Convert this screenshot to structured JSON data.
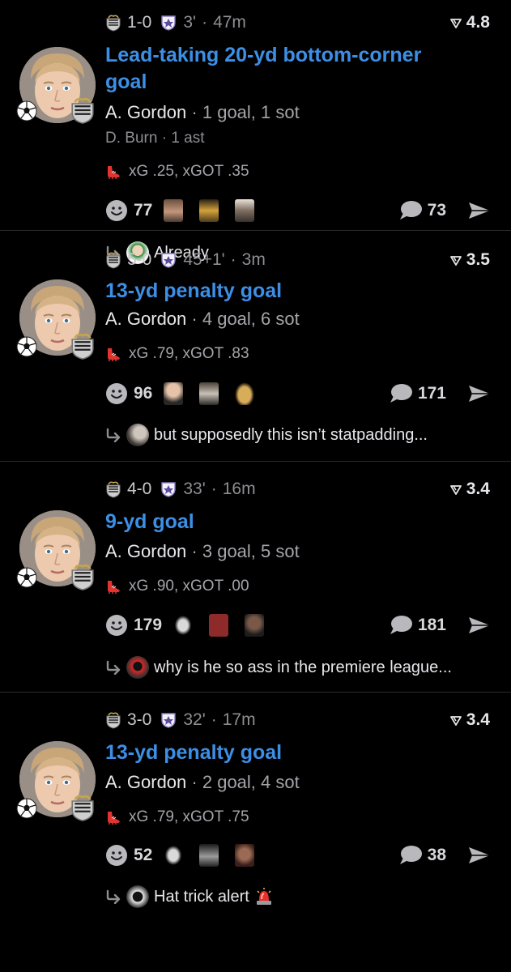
{
  "feed": {
    "cards": [
      {
        "score": "1-0",
        "minute": "3'",
        "time_ago": "47m",
        "rating": "4.8",
        "title_line1": "Lead-taking 20-yd bottom-corner",
        "title_line2": "goal",
        "player": "A. Gordon",
        "player_stat": "1 goal, 1 sot",
        "assist_player": "D. Burn",
        "assist_stat": "1 ast",
        "xg": "xG .25, xGOT .35",
        "reaction_count": "77",
        "comment_count": "73",
        "reply_text": "Already"
      },
      {
        "score": "5-0",
        "minute": "45+1'",
        "time_ago": "3m",
        "rating": "3.5",
        "title_line1": "13-yd penalty goal",
        "title_line2": "",
        "player": "A. Gordon",
        "player_stat": "4 goal, 6 sot",
        "assist_player": "",
        "assist_stat": "",
        "xg": "xG .79, xGOT .83",
        "reaction_count": "96",
        "comment_count": "171",
        "reply_text": "but supposedly this isn’t statpadding..."
      },
      {
        "score": "4-0",
        "minute": "33'",
        "time_ago": "16m",
        "rating": "3.4",
        "title_line1": "9-yd goal",
        "title_line2": "",
        "player": "A. Gordon",
        "player_stat": "3 goal, 5 sot",
        "assist_player": "",
        "assist_stat": "",
        "xg": "xG .90, xGOT .00",
        "reaction_count": "179",
        "comment_count": "181",
        "reply_text": "why is he so ass in the premiere league..."
      },
      {
        "score": "3-0",
        "minute": "32'",
        "time_ago": "17m",
        "rating": "3.4",
        "title_line1": "13-yd penalty goal",
        "title_line2": "",
        "player": "A. Gordon",
        "player_stat": "2 goal, 4 sot",
        "assist_player": "",
        "assist_stat": "",
        "xg": "xG .79, xGOT .75",
        "reaction_count": "52",
        "comment_count": "38",
        "reply_text": "Hat trick alert"
      }
    ]
  },
  "separator": "·",
  "icons": {
    "team_crest": "newcastle-crest-icon",
    "opponent_crest": "opponent-crest-icon",
    "rating": "rating-chevron-icon",
    "goal": "soccer-ball-icon",
    "shoe": "boot-icon",
    "react": "smiley-react-icon",
    "comment": "comment-bubble-icon",
    "share": "share-arrow-icon",
    "reply": "reply-arrow-icon",
    "siren": "siren-emoji-icon"
  },
  "colors": {
    "background": "#000000",
    "title_blue": "#3d8fe6",
    "muted": "#8e8e93",
    "boot_red": "#e2342f"
  }
}
